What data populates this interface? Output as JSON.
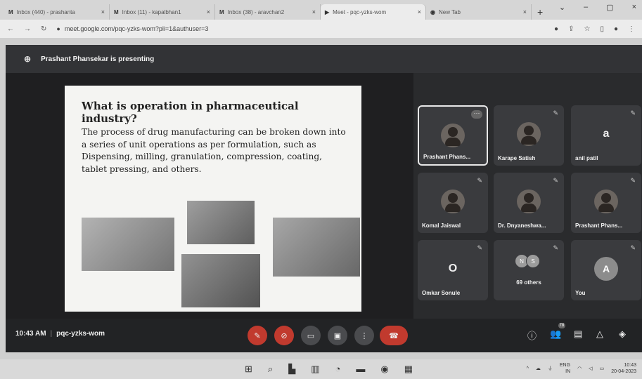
{
  "browser": {
    "tabs": [
      {
        "favicon": "M",
        "title": "Inbox (440) - prashanta"
      },
      {
        "favicon": "M",
        "title": "Inbox (11) - kapalbhan1"
      },
      {
        "favicon": "M",
        "title": "Inbox (38) - aravchan2"
      },
      {
        "favicon": "▶",
        "title": "Meet - pqc-yzks-wom"
      },
      {
        "favicon": "◉",
        "title": "New Tab"
      }
    ],
    "new_tab_icon": "+",
    "window_controls": [
      "⌄",
      "–",
      "▢",
      "×"
    ],
    "url": "meet.google.com/pqc-yzks-wom?pli=1&authuser=3"
  },
  "meet": {
    "presenter_text": "Prashant Phansekar is presenting",
    "slide": {
      "title": "What is operation in pharmaceutical industry?",
      "body": "The process of drug manufacturing can be broken down into a series of unit operations as per formulation, such as Dispensing, milling, granulation, compression, coating, tablet pressing, and others."
    },
    "tiles": [
      {
        "name": "Prashant Phans...",
        "type": "photo",
        "active": true
      },
      {
        "name": "Karape Satish",
        "type": "photo"
      },
      {
        "name": "anil patil",
        "type": "letter",
        "letter": "a"
      },
      {
        "name": "Komal Jaiswal",
        "type": "photo"
      },
      {
        "name": "Dr. Dnyaneshwa...",
        "type": "photo"
      },
      {
        "name": "Prashant Phans...",
        "type": "photo"
      },
      {
        "name": "Omkar Sonule",
        "type": "letter",
        "letter": "O"
      },
      {
        "name": "69 others",
        "type": "others",
        "initials": [
          "N",
          "S"
        ]
      },
      {
        "name": "You",
        "type": "you",
        "letter": "A"
      }
    ],
    "time": "10:43 AM",
    "meeting_code": "pqc-yzks-wom",
    "participants_count": "78"
  },
  "taskbar": {
    "lang_top": "ENG",
    "lang_bottom": "IN",
    "time": "10:43",
    "date": "20-04-2023"
  },
  "colors": {
    "end_call": "#c13a2e",
    "tile_bg": "#3a3b3e",
    "active_border": "#e8e8e8"
  }
}
